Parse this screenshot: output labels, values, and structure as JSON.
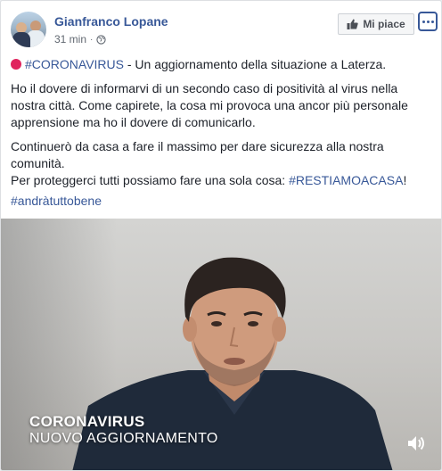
{
  "post": {
    "author": "Gianfranco Lopane",
    "time": "31 min",
    "separator": "·",
    "like_label": "Mi piace",
    "hashtag_corona": "#CORONAVIRUS",
    "line1_rest": " - Un aggiornamento della situazione a Laterza.",
    "para2": "Ho il dovere di informarvi di un secondo caso di positività al virus nella nostra città. Come capirete, la cosa mi provoca una ancor più personale apprensione ma ho il dovere di comunicarlo.",
    "para3a": "Continuerò da casa a fare il massimo per dare sicurezza alla nostra comunità.",
    "para3b_text": "Per proteggerci tutti possiamo fare una sola cosa: ",
    "hashtag_resta": "#RESTIAMOACASA",
    "para3b_end": "!",
    "hashtag_andra": "#andràtuttobene"
  },
  "video": {
    "caption_line1": "CORONAVIRUS",
    "caption_line2": "NUOVO AGGIORNAMENTO"
  },
  "colors": {
    "link": "#385898",
    "text": "#1d2129",
    "meta": "#606770",
    "red_dot": "#e0245e"
  },
  "icons": [
    "globe-icon",
    "thumbs-up-icon",
    "more-icon",
    "red-circle-icon",
    "volume-icon"
  ]
}
